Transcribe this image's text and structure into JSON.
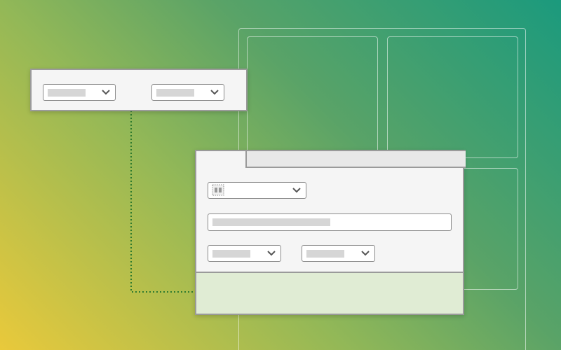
{
  "theme": {
    "panel_background": "#f5f5f5",
    "panel_border": "#9a9a9a",
    "footer_background": "#e0ecd4",
    "tab_background": "#e8e8e8",
    "placeholder_color": "#d6d6d6",
    "connector_color": "#2e7a2e"
  },
  "filter_panel": {
    "dropdowns": [
      {
        "name": "filter-dropdown-1",
        "icon": "chevron-down-icon"
      },
      {
        "name": "filter-dropdown-2",
        "icon": "chevron-down-icon"
      }
    ]
  },
  "settings_panel": {
    "layout_select": {
      "icon": "layout-icon",
      "dropdown_icon": "chevron-down-icon"
    },
    "text_field": {
      "value": ""
    },
    "dropdowns": [
      {
        "name": "settings-dropdown-1",
        "icon": "chevron-down-icon"
      },
      {
        "name": "settings-dropdown-2",
        "icon": "chevron-down-icon"
      }
    ]
  }
}
